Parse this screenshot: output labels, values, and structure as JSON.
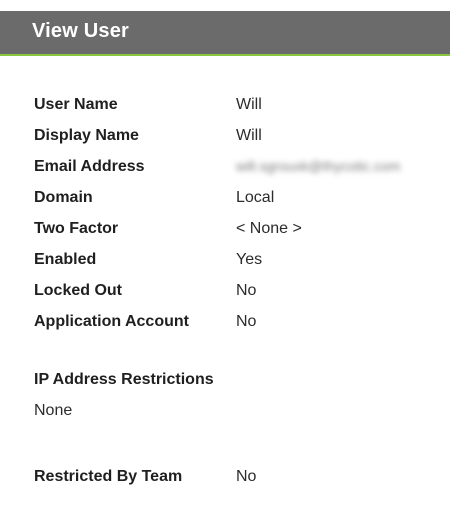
{
  "header": {
    "title": "View User"
  },
  "fields": [
    {
      "label": "User Name",
      "value": "Will"
    },
    {
      "label": "Display Name",
      "value": "Will"
    },
    {
      "label": "Email Address",
      "value": "will.sgrouxk@thycotic.com"
    },
    {
      "label": "Domain",
      "value": "Local"
    },
    {
      "label": "Two Factor",
      "value": "< None >"
    },
    {
      "label": "Enabled",
      "value": "Yes"
    },
    {
      "label": "Locked Out",
      "value": "No"
    },
    {
      "label": "Application Account",
      "value": "No"
    }
  ],
  "ip_restrictions": {
    "title": "IP Address Restrictions",
    "value": "None"
  },
  "restricted_by_team": {
    "label": "Restricted By Team",
    "value": "No"
  }
}
